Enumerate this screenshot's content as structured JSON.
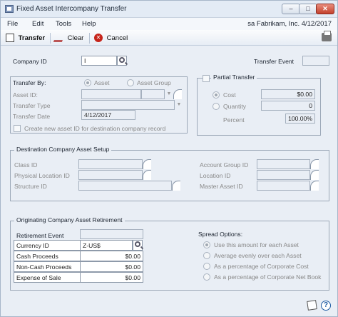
{
  "window": {
    "title": "Fixed Asset Intercompany Transfer",
    "controls": [
      "–",
      "□",
      "✕"
    ]
  },
  "menu": {
    "items": [
      "File",
      "Edit",
      "Tools",
      "Help"
    ],
    "company_date": "sa  Fabrikam, Inc.  4/12/2017"
  },
  "toolbar": {
    "transfer_label": "Transfer",
    "clear_label": "Clear",
    "cancel_label": "Cancel"
  },
  "top": {
    "company_id_label": "Company ID",
    "company_id_value": "I",
    "transfer_event_label": "Transfer Event"
  },
  "transfer_by": {
    "label": "Transfer By:",
    "asset_option": "Asset",
    "asset_group_option": "Asset Group",
    "asset_id_label": "Asset ID:",
    "transfer_type_label": "Transfer Type",
    "transfer_date_label": "Transfer Date",
    "transfer_date_value": "4/12/2017",
    "create_new_label": "Create new asset ID for destination company record"
  },
  "partial": {
    "title": "Partial Transfer",
    "cost_label": "Cost",
    "cost_value": "$0.00",
    "quantity_label": "Quantity",
    "quantity_value": "0",
    "percent_label": "Percent",
    "percent_value": "100.00%"
  },
  "destination": {
    "title": "Destination Company Asset Setup",
    "class_id": "Class ID",
    "physical_location_id": "Physical Location ID",
    "structure_id": "Structure ID",
    "account_group_id": "Account Group ID",
    "location_id": "Location ID",
    "master_asset_id": "Master Asset ID"
  },
  "originating": {
    "title": "Originating Company Asset Retirement",
    "retirement_event": "Retirement Event",
    "currency_id_label": "Currency ID",
    "currency_id_value": "Z-US$",
    "cash_proceeds_label": "Cash Proceeds",
    "cash_proceeds_value": "$0.00",
    "noncash_proceeds_label": "Non-Cash Proceeds",
    "noncash_proceeds_value": "$0.00",
    "expense_label": "Expense of Sale",
    "expense_value": "$0.00",
    "spread_title": "Spread Options:",
    "spread_1": "Use this amount for each Asset",
    "spread_2": "Average evenly over each Asset",
    "spread_3": "As a percentage of Corporate Cost",
    "spread_4": "As a percentage of Corporate Net Book"
  }
}
